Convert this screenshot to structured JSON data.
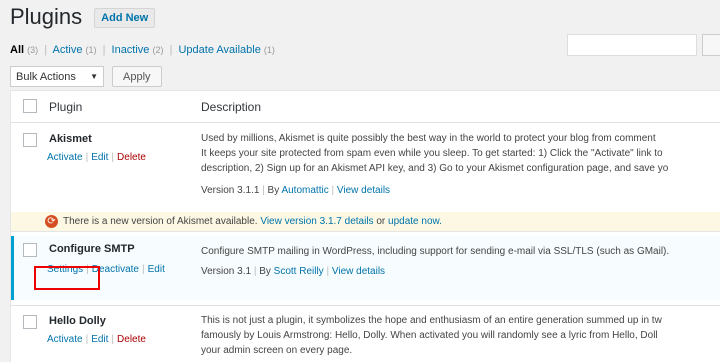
{
  "page": {
    "title": "Plugins",
    "add_new": "Add New"
  },
  "filters": [
    {
      "label": "All",
      "count": "(3)",
      "current": true
    },
    {
      "label": "Active",
      "count": "(1)"
    },
    {
      "label": "Inactive",
      "count": "(2)"
    },
    {
      "label": "Update Available",
      "count": "(1)"
    }
  ],
  "bulk": {
    "select_value": "Bulk Actions",
    "apply": "Apply"
  },
  "table": {
    "col_plugin": "Plugin",
    "col_description": "Description"
  },
  "plugins": [
    {
      "name": "Akismet",
      "actions": [
        "Activate",
        "Edit",
        "Delete"
      ],
      "description_lines": [
        "Used by millions, Akismet is quite possibly the best way in the world to protect your blog from comment",
        "It keeps your site protected from spam even while you sleep. To get started: 1) Click the \"Activate\" link to",
        "description, 2) Sign up for an Akismet API key, and 3) Go to your Akismet configuration page, and save yo"
      ],
      "version": "Version 3.1.1",
      "by_label": "By",
      "author": "Automattic",
      "view_details": "View details"
    },
    {
      "name": "Configure SMTP",
      "actions": [
        "Settings",
        "Deactivate",
        "Edit"
      ],
      "description_lines": [
        "Configure SMTP mailing in WordPress, including support for sending e-mail via SSL/TLS (such as GMail)."
      ],
      "version": "Version 3.1",
      "by_label": "By",
      "author": "Scott Reilly",
      "view_details": "View details"
    },
    {
      "name": "Hello Dolly",
      "actions": [
        "Activate",
        "Edit",
        "Delete"
      ],
      "description_lines": [
        "This is not just a plugin, it symbolizes the hope and enthusiasm of an entire generation summed up in tw",
        "famously by Louis Armstrong: Hello, Dolly. When activated you will randomly see a lyric from Hello, Doll",
        "your admin screen on every page."
      ]
    }
  ],
  "update_notice": {
    "text_before": "There is a new version of Akismet available.",
    "view_version": "View version 3.1.7 details",
    "or": "or",
    "update_now": "update now."
  }
}
